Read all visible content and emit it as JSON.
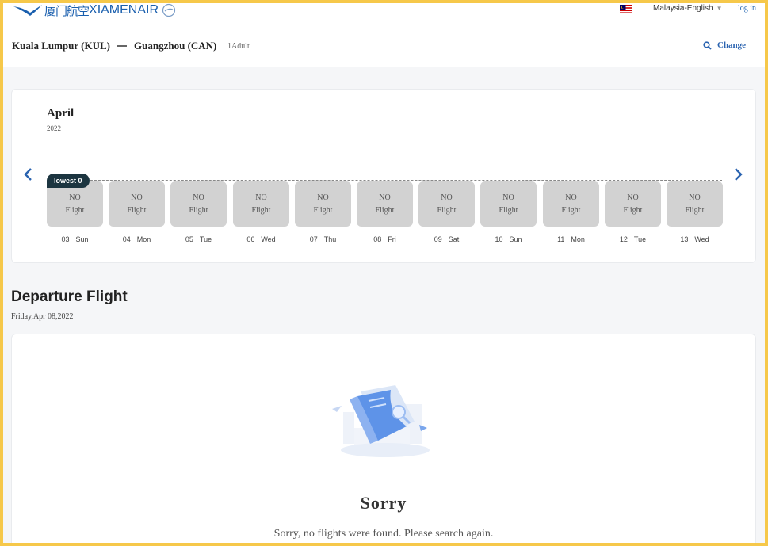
{
  "header": {
    "logo_cn": "厦门航空",
    "logo_en": "XIAMENAIR",
    "language": "Malaysia-English",
    "login": "log in"
  },
  "search": {
    "origin": "Kuala Lumpur (KUL)",
    "destination": "Guangzhou (CAN)",
    "passengers": "1Adult",
    "change_label": "Change"
  },
  "calendar": {
    "month": "April",
    "year": "2022",
    "lowest_badge": "lowest 0",
    "days": [
      {
        "num": "03",
        "weekday": "Sun",
        "line1": "NO",
        "line2": "Flight"
      },
      {
        "num": "04",
        "weekday": "Mon",
        "line1": "NO",
        "line2": "Flight"
      },
      {
        "num": "05",
        "weekday": "Tue",
        "line1": "NO",
        "line2": "Flight"
      },
      {
        "num": "06",
        "weekday": "Wed",
        "line1": "NO",
        "line2": "Flight"
      },
      {
        "num": "07",
        "weekday": "Thu",
        "line1": "NO",
        "line2": "Flight"
      },
      {
        "num": "08",
        "weekday": "Fri",
        "line1": "NO",
        "line2": "Flight"
      },
      {
        "num": "09",
        "weekday": "Sat",
        "line1": "NO",
        "line2": "Flight"
      },
      {
        "num": "10",
        "weekday": "Sun",
        "line1": "NO",
        "line2": "Flight"
      },
      {
        "num": "11",
        "weekday": "Mon",
        "line1": "NO",
        "line2": "Flight"
      },
      {
        "num": "12",
        "weekday": "Tue",
        "line1": "NO",
        "line2": "Flight"
      },
      {
        "num": "13",
        "weekday": "Wed",
        "line1": "NO",
        "line2": "Flight"
      }
    ]
  },
  "departure": {
    "title": "Departure Flight",
    "date": "Friday,Apr 08,2022"
  },
  "empty_state": {
    "title": "Sorry",
    "message": "Sorry, no flights were found. Please search again."
  },
  "colors": {
    "brand_blue": "#1a5fae",
    "badge_dark": "#1c3540",
    "day_gray": "#d2d2d2"
  }
}
